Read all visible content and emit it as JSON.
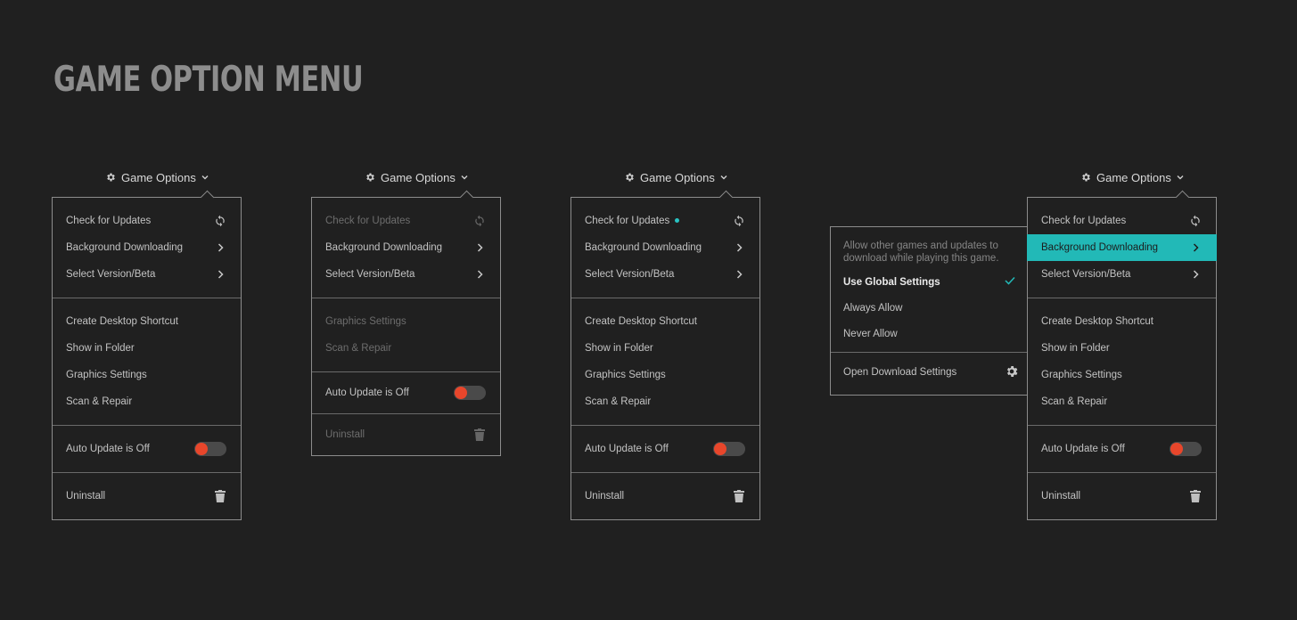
{
  "page": {
    "title": "GAME OPTION MENU"
  },
  "colors": {
    "background": "#202020",
    "accent": "#22b9b7",
    "toggle_off": "#e8462b",
    "border": "#8c8c8c"
  },
  "trigger": {
    "label": "Game Options",
    "icon": "gear-icon",
    "chevron": "chevron-down-icon"
  },
  "menus": {
    "m1": {
      "check_updates": "Check for Updates",
      "background_downloading": "Background Downloading",
      "select_version": "Select Version/Beta",
      "create_shortcut": "Create Desktop Shortcut",
      "show_in_folder": "Show in Folder",
      "graphics_settings": "Graphics Settings",
      "scan_repair": "Scan & Repair",
      "auto_update": "Auto Update is Off",
      "uninstall": "Uninstall"
    },
    "m2": {
      "check_updates": "Check for Updates",
      "background_downloading": "Background Downloading",
      "select_version": "Select Version/Beta",
      "graphics_settings": "Graphics Settings",
      "scan_repair": "Scan & Repair",
      "auto_update": "Auto Update is Off",
      "uninstall": "Uninstall"
    },
    "m3": {
      "check_updates": "Check for Updates",
      "background_downloading": "Background Downloading",
      "select_version": "Select Version/Beta",
      "create_shortcut": "Create Desktop Shortcut",
      "show_in_folder": "Show in Folder",
      "graphics_settings": "Graphics Settings",
      "scan_repair": "Scan & Repair",
      "auto_update": "Auto Update is Off",
      "uninstall": "Uninstall"
    },
    "m4": {
      "check_updates": "Check for Updates",
      "background_downloading": "Background Downloading",
      "select_version": "Select Version/Beta",
      "create_shortcut": "Create Desktop Shortcut",
      "show_in_folder": "Show in Folder",
      "graphics_settings": "Graphics Settings",
      "scan_repair": "Scan & Repair",
      "auto_update": "Auto Update is Off",
      "uninstall": "Uninstall"
    }
  },
  "submenu": {
    "description": "Allow other games and updates to download while playing this game.",
    "options": [
      "Use Global Settings",
      "Always Allow",
      "Never Allow"
    ],
    "selected": "Use Global Settings",
    "footer": "Open Download Settings"
  }
}
